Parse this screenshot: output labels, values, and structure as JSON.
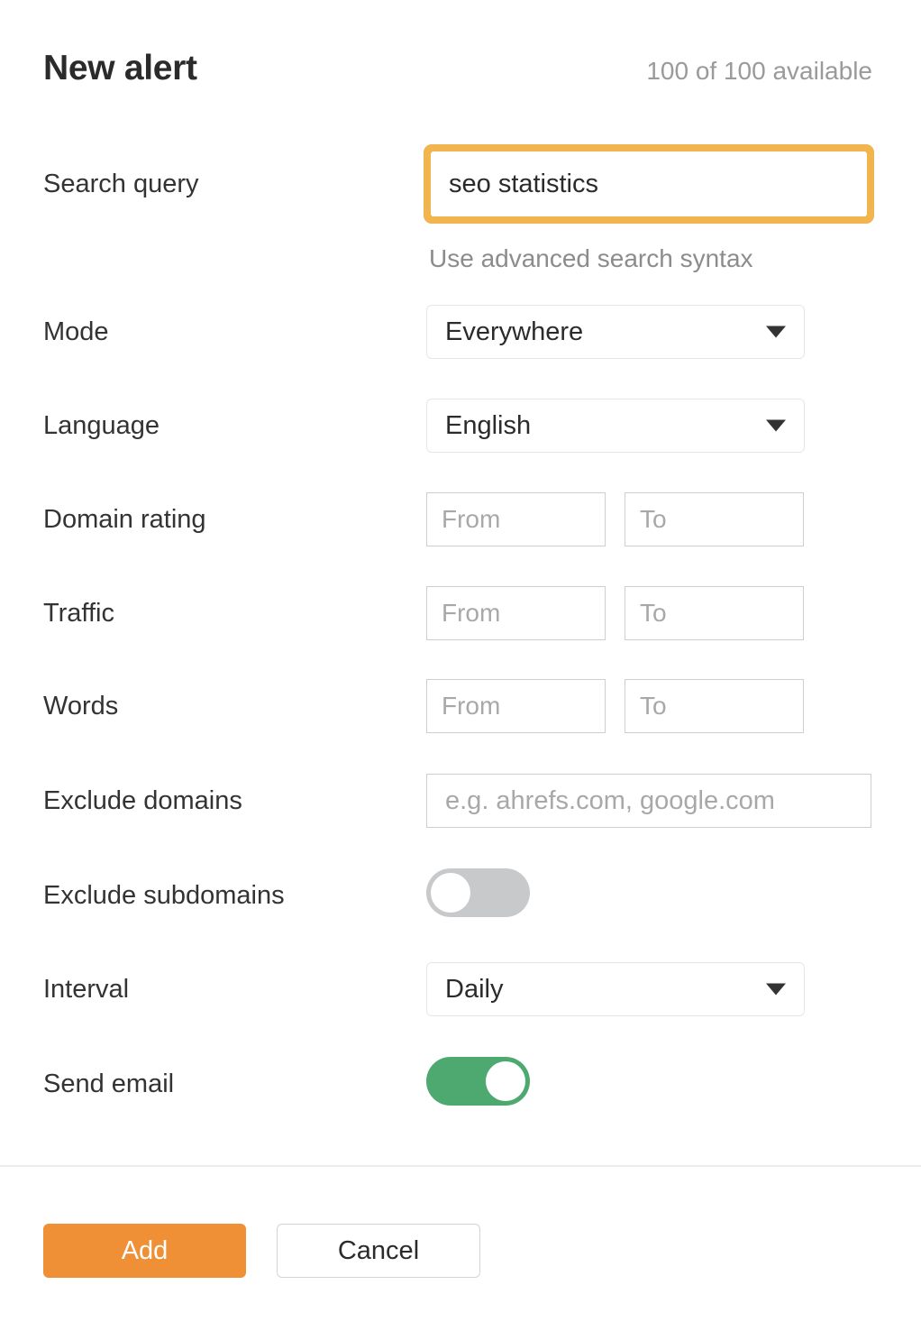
{
  "header": {
    "title": "New alert",
    "quota": "100 of 100 available"
  },
  "form": {
    "search_query": {
      "label": "Search query",
      "value": "seo statistics",
      "placeholder": "",
      "hint": "Use advanced search syntax"
    },
    "mode": {
      "label": "Mode",
      "value": "Everywhere",
      "arrow_icon": "chevron-down-icon"
    },
    "language": {
      "label": "Language",
      "value": "English",
      "arrow_icon": "chevron-down-icon"
    },
    "domain_rating": {
      "label": "Domain rating",
      "from_value": "",
      "from_placeholder": "From",
      "to_value": "",
      "to_placeholder": "To"
    },
    "traffic": {
      "label": "Traffic",
      "from_value": "",
      "from_placeholder": "From",
      "to_value": "",
      "to_placeholder": "To"
    },
    "words": {
      "label": "Words",
      "from_value": "",
      "from_placeholder": "From",
      "to_value": "",
      "to_placeholder": "To"
    },
    "exclude_domains": {
      "label": "Exclude domains",
      "value": "",
      "placeholder": "e.g. ahrefs.com, google.com"
    },
    "exclude_subdomains": {
      "label": "Exclude subdomains",
      "state": "off"
    },
    "interval": {
      "label": "Interval",
      "value": "Daily",
      "arrow_icon": "chevron-down-icon"
    },
    "send_email": {
      "label": "Send email",
      "state": "on"
    }
  },
  "footer": {
    "add_label": "Add",
    "cancel_label": "Cancel"
  },
  "colors": {
    "accent_orange": "#ef9036",
    "focus_ring": "#f2b44d",
    "toggle_on_green": "#4da96f",
    "toggle_off_gray": "#c7c9cb",
    "text_primary": "#2b2b2b",
    "text_muted": "#9a9a9a"
  }
}
